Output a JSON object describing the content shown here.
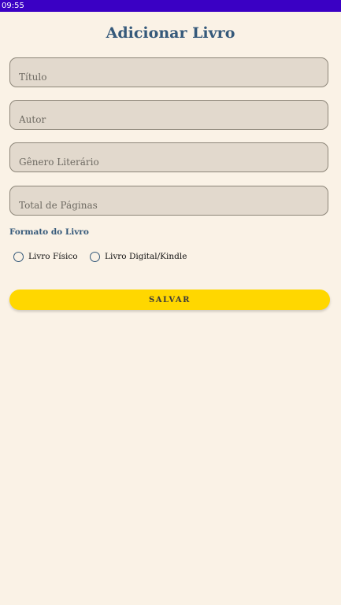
{
  "status_bar": {
    "time": "09:55"
  },
  "page": {
    "title": "Adicionar Livro"
  },
  "form": {
    "fields": [
      {
        "placeholder": "Título",
        "value": ""
      },
      {
        "placeholder": "Autor",
        "value": ""
      },
      {
        "placeholder": "Gênero Literário",
        "value": ""
      },
      {
        "placeholder": "Total de Páginas",
        "value": ""
      }
    ],
    "format_label": "Formato do Livro",
    "format_options": [
      {
        "label": "Livro Físico",
        "selected": false
      },
      {
        "label": "Livro Digital/Kindle",
        "selected": false
      }
    ],
    "save_label": "SALVAR"
  },
  "colors": {
    "background": "#FAF2E6",
    "status_bar": "#3A00C4",
    "title": "#35597A",
    "field_background": "#E2D9CD",
    "save_button": "#FFD700"
  }
}
